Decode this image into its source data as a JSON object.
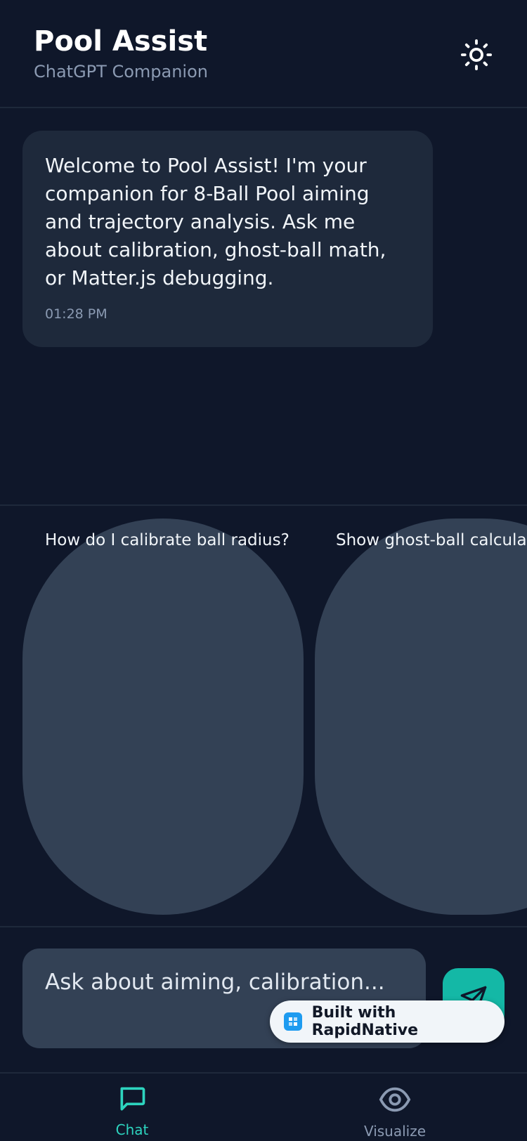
{
  "header": {
    "title": "Pool Assist",
    "subtitle": "ChatGPT Companion",
    "theme_icon": "sun-icon"
  },
  "messages": [
    {
      "role": "assistant",
      "text": "Welcome to Pool Assist! I'm your companion for 8-Ball Pool aiming and trajectory analysis. Ask me about calibration, ghost-ball math, or Matter.js debugging.",
      "time": "01:28 PM"
    }
  ],
  "suggestions": [
    "How do I calibrate ball radius?",
    "Show ghost-ball calculati"
  ],
  "input": {
    "placeholder": "Ask about aiming, calibration..."
  },
  "badge": {
    "text": "Built with RapidNative"
  },
  "nav": {
    "items": [
      {
        "label": "Chat",
        "icon": "chat-icon",
        "active": true
      },
      {
        "label": "Visualize",
        "icon": "eye-icon",
        "active": false
      }
    ]
  },
  "colors": {
    "background": "#0f172a",
    "surface": "#1e293b",
    "chip": "#334155",
    "accent": "#14b8a6"
  }
}
